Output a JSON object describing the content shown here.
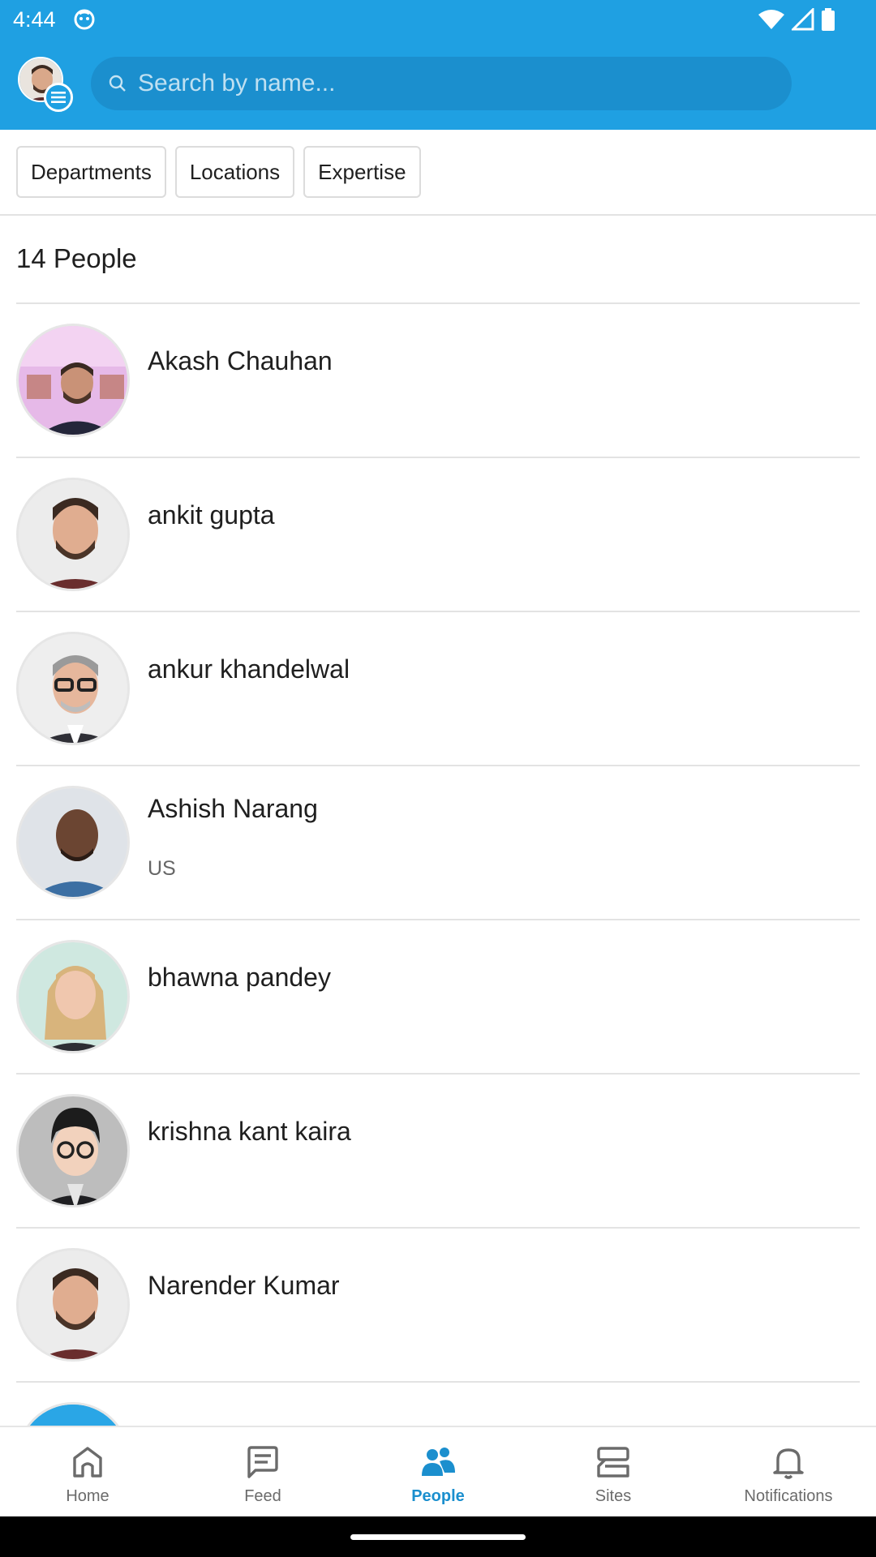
{
  "status_bar": {
    "time": "4:44"
  },
  "header": {
    "search": {
      "placeholder": "Search by name..."
    }
  },
  "filters": [
    "Departments",
    "Locations",
    "Expertise"
  ],
  "people_count": "14 People",
  "people": [
    {
      "name": "Akash Chauhan",
      "subtitle": ""
    },
    {
      "name": "ankit gupta",
      "subtitle": ""
    },
    {
      "name": "ankur khandelwal",
      "subtitle": ""
    },
    {
      "name": "Ashish Narang",
      "subtitle": "US"
    },
    {
      "name": "bhawna pandey",
      "subtitle": ""
    },
    {
      "name": "krishna kant kaira",
      "subtitle": ""
    },
    {
      "name": "Narender Kumar",
      "subtitle": ""
    }
  ],
  "bottom_nav": [
    {
      "label": "Home",
      "icon": "home-icon",
      "active": false
    },
    {
      "label": "Feed",
      "icon": "feed-icon",
      "active": false
    },
    {
      "label": "People",
      "icon": "people-icon",
      "active": true
    },
    {
      "label": "Sites",
      "icon": "sites-icon",
      "active": false
    },
    {
      "label": "Notifications",
      "icon": "bell-icon",
      "active": false
    }
  ],
  "colors": {
    "brand": "#1fa0e2",
    "active": "#1b8fce"
  }
}
